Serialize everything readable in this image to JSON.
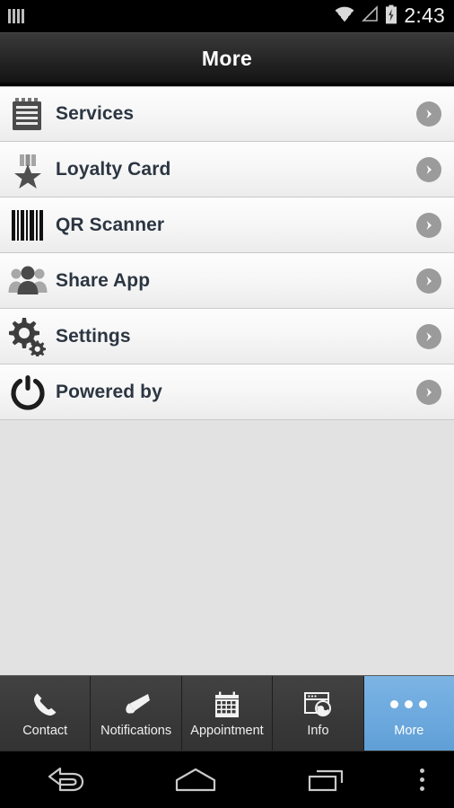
{
  "status_bar": {
    "notification_icon": "barcode-icon",
    "wifi_icon": "wifi-icon",
    "cellular_icon": "cellular-signal-icon",
    "battery_icon": "battery-charging-icon",
    "time": "2:43"
  },
  "title_bar": {
    "title": "More"
  },
  "list": {
    "items": [
      {
        "label": "Services",
        "icon": "notepad-icon",
        "chevron": "chevron-right-icon"
      },
      {
        "label": "Loyalty Card",
        "icon": "medal-icon",
        "chevron": "chevron-right-icon"
      },
      {
        "label": "QR Scanner",
        "icon": "barcode-icon",
        "chevron": "chevron-right-icon"
      },
      {
        "label": "Share App",
        "icon": "people-icon",
        "chevron": "chevron-right-icon"
      },
      {
        "label": "Settings",
        "icon": "gears-icon",
        "chevron": "chevron-right-icon"
      },
      {
        "label": "Powered by",
        "icon": "power-icon",
        "chevron": "chevron-right-icon"
      }
    ]
  },
  "tab_bar": {
    "active_index": 4,
    "active_color": "#6ba8dd",
    "tabs": [
      {
        "label": "Contact",
        "icon": "phone-icon"
      },
      {
        "label": "Notifications",
        "icon": "megaphone-icon"
      },
      {
        "label": "Appointment",
        "icon": "calendar-icon"
      },
      {
        "label": "Info",
        "icon": "browser-globe-icon"
      },
      {
        "label": "More",
        "icon": "three-dots-icon"
      }
    ]
  },
  "nav_bar": {
    "back": "back-icon",
    "home": "home-icon",
    "recents": "recents-icon",
    "menu": "overflow-menu-icon"
  },
  "colors": {
    "accent": "#6ba8dd",
    "text": "#2c3642",
    "page_background": "#e2e2e2"
  }
}
